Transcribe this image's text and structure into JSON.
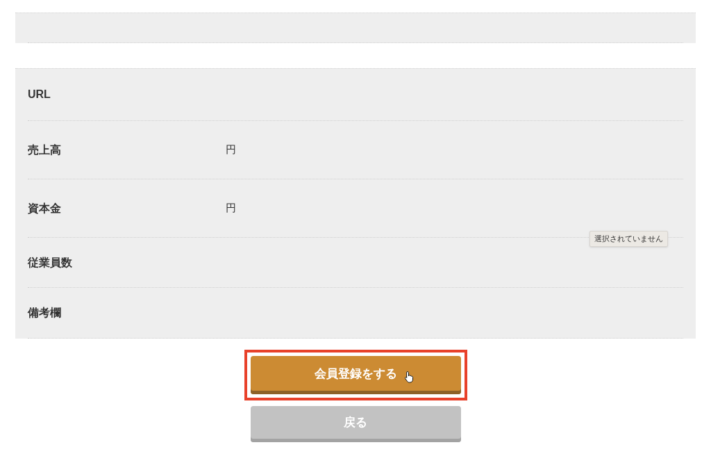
{
  "fields": [
    {
      "label": "URL"
    },
    {
      "label": "売上高",
      "unit": "円"
    },
    {
      "label": "資本金",
      "unit": "円"
    },
    {
      "label": "従業員数"
    },
    {
      "label": "備考欄"
    }
  ],
  "tooltip": "選択されていません",
  "buttons": [
    {
      "label": "会員登録をする",
      "kind": "primary",
      "highlighted": true
    },
    {
      "label": "戻る",
      "kind": "secondary",
      "highlighted": false
    }
  ]
}
